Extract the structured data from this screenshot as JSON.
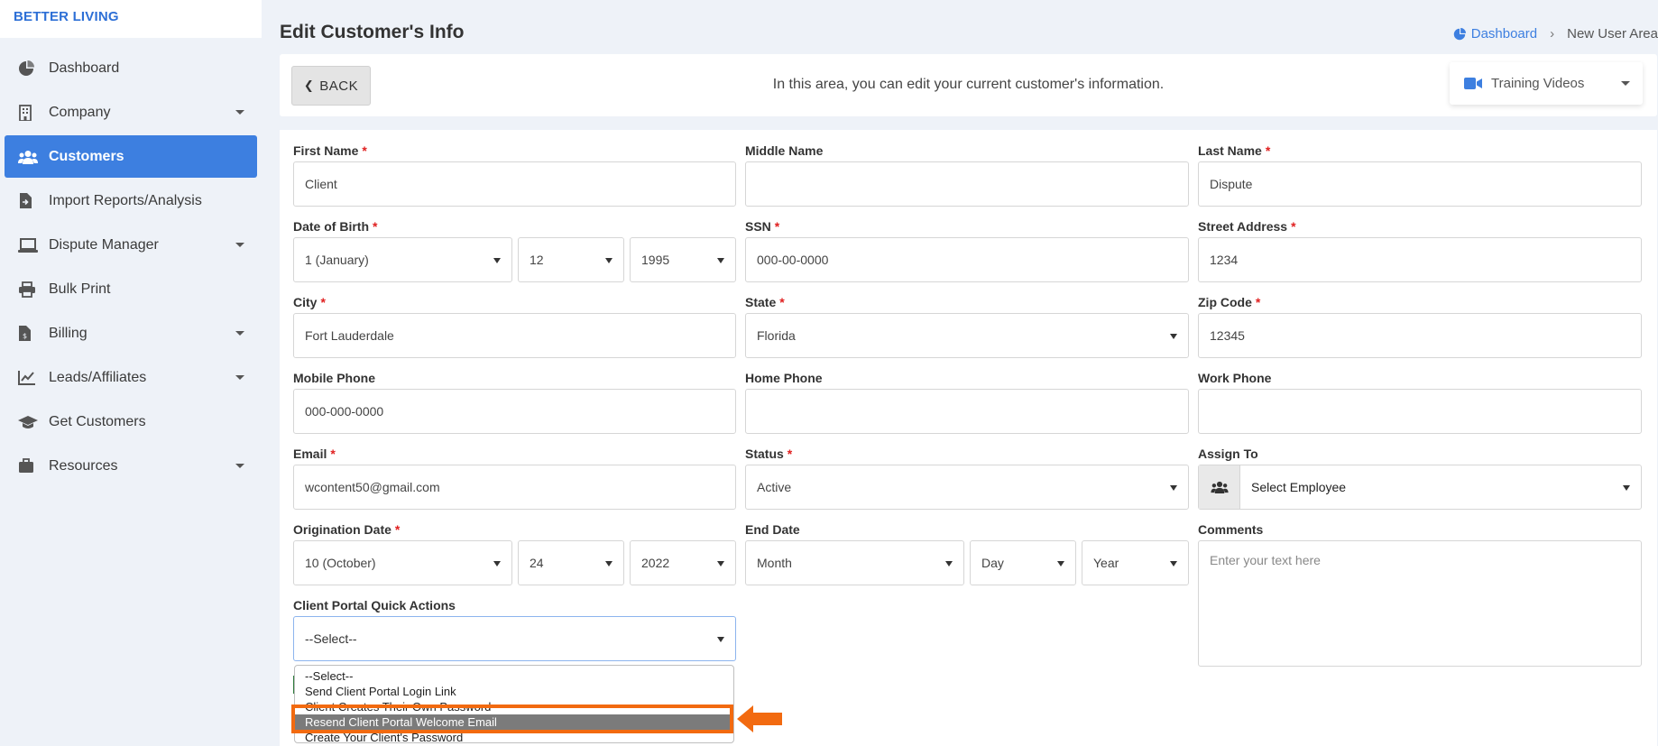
{
  "brand": "BETTER LIVING",
  "sidebar": {
    "items": [
      {
        "label": "Dashboard",
        "icon": "pie-chart-icon",
        "caret": false,
        "active": false
      },
      {
        "label": "Company",
        "icon": "building-icon",
        "caret": true,
        "active": false
      },
      {
        "label": "Customers",
        "icon": "users-icon",
        "caret": false,
        "active": true
      },
      {
        "label": "Import Reports/Analysis",
        "icon": "file-import-icon",
        "caret": false,
        "active": false
      },
      {
        "label": "Dispute Manager",
        "icon": "laptop-icon",
        "caret": true,
        "active": false
      },
      {
        "label": "Bulk Print",
        "icon": "printer-icon",
        "caret": false,
        "active": false
      },
      {
        "label": "Billing",
        "icon": "invoice-icon",
        "caret": true,
        "active": false
      },
      {
        "label": "Leads/Affiliates",
        "icon": "chart-line-icon",
        "caret": true,
        "active": false
      },
      {
        "label": "Get Customers",
        "icon": "graduation-cap-icon",
        "caret": false,
        "active": false
      },
      {
        "label": "Resources",
        "icon": "briefcase-icon",
        "caret": true,
        "active": false
      }
    ]
  },
  "header": {
    "title": "Edit Customer's Info",
    "breadcrumb_home": "Dashboard",
    "breadcrumb_current": "New User Area"
  },
  "topbar": {
    "back_label": "BACK",
    "message": "In this area, you can edit your current customer's information.",
    "training_label": "Training Videos"
  },
  "form": {
    "first_name_label": "First Name",
    "first_name": "Client",
    "middle_name_label": "Middle Name",
    "middle_name": "",
    "last_name_label": "Last Name",
    "last_name": "Dispute",
    "dob_label": "Date of Birth",
    "dob_month": "1 (January)",
    "dob_day": "12",
    "dob_year": "1995",
    "ssn_label": "SSN",
    "ssn": "000-00-0000",
    "street_label": "Street Address",
    "street": "1234",
    "city_label": "City",
    "city": "Fort Lauderdale",
    "state_label": "State",
    "state": "Florida",
    "zip_label": "Zip Code",
    "zip": "12345",
    "mobile_label": "Mobile Phone",
    "mobile": "000-000-0000",
    "home_label": "Home Phone",
    "home": "",
    "work_label": "Work Phone",
    "work": "",
    "email_label": "Email",
    "email": "wcontent50@gmail.com",
    "status_label": "Status",
    "status": "Active",
    "assign_label": "Assign To",
    "assign": "Select Employee",
    "orig_label": "Origination Date",
    "orig_month": "10 (October)",
    "orig_day": "24",
    "orig_year": "2022",
    "end_label": "End Date",
    "end_month": "Month",
    "end_day": "Day",
    "end_year": "Year",
    "comments_label": "Comments",
    "comments_placeholder": "Enter your text here",
    "quick_label": "Client Portal Quick Actions",
    "quick_value": "--Select--",
    "quick_options": [
      "--Select--",
      "Send Client Portal Login Link",
      "Client Creates Their Own Password",
      "Resend Client Portal Welcome Email",
      "Create Your Client's Password"
    ],
    "quick_highlighted_index": 3
  },
  "colors": {
    "accent": "#3d7fe0",
    "required": "#e02020",
    "highlight_box": "#f26a10"
  }
}
